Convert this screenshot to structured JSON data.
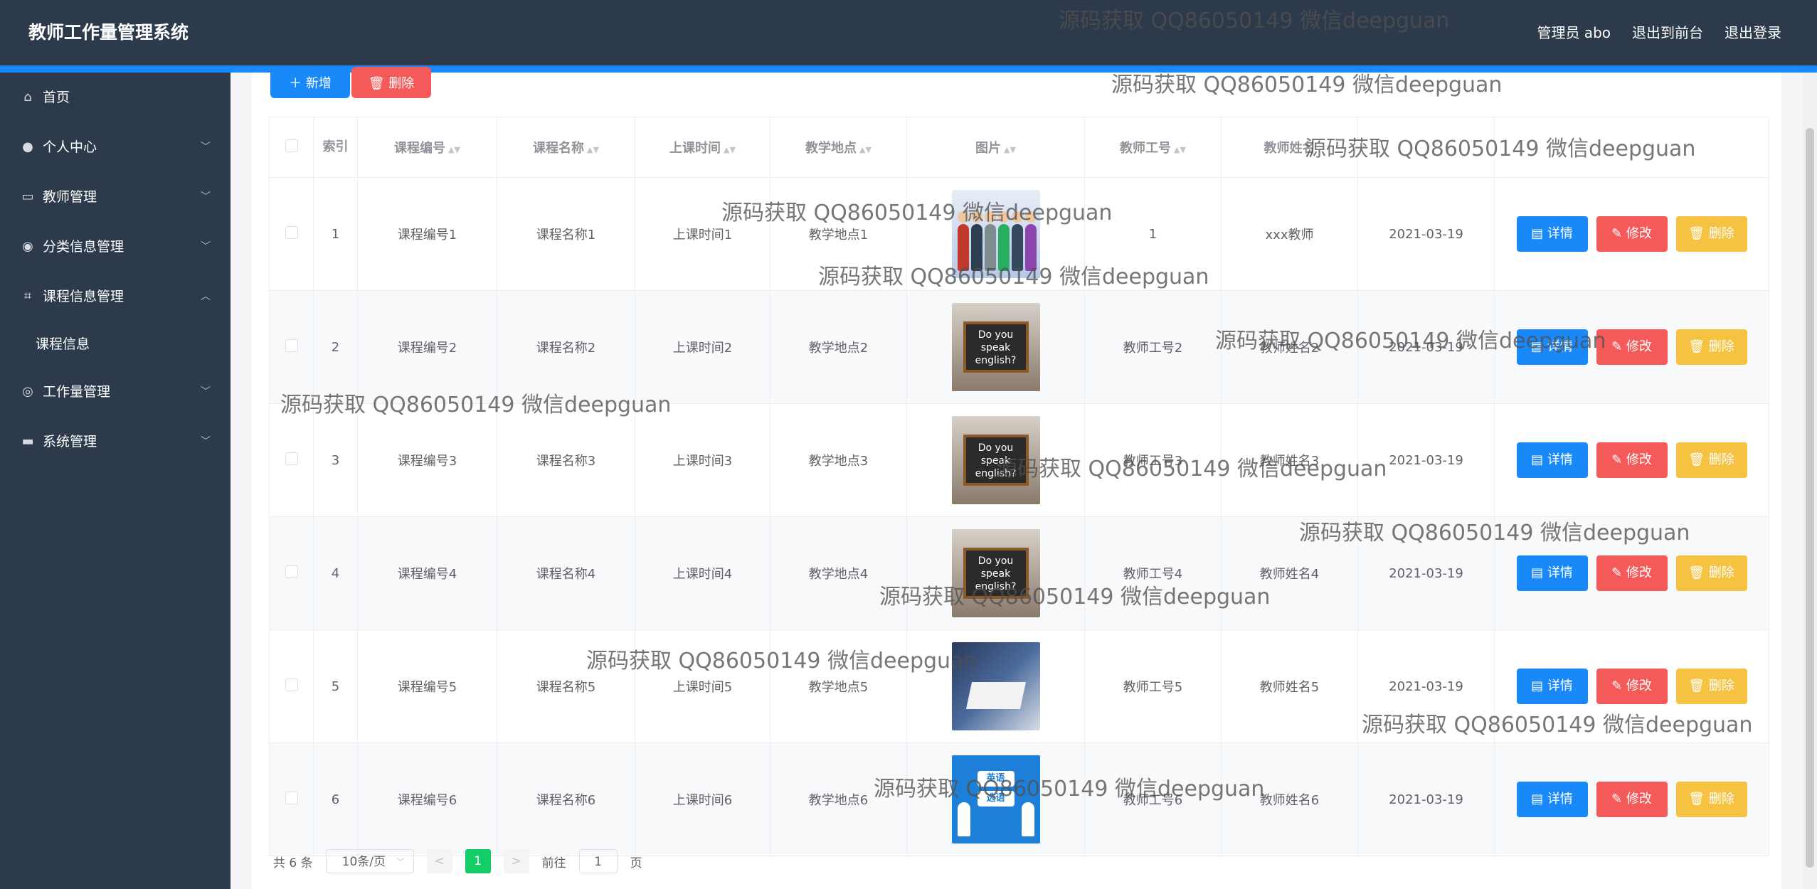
{
  "header": {
    "title": "教师工作量管理系统",
    "user": "管理员 abo",
    "front": "退出到前台",
    "logout": "退出登录"
  },
  "sidebar": {
    "items": [
      {
        "label": "首页",
        "icon": "home-icon"
      },
      {
        "label": "个人中心",
        "icon": "user-icon"
      },
      {
        "label": "教师管理",
        "icon": "monitor-icon"
      },
      {
        "label": "分类信息管理",
        "icon": "location-icon"
      },
      {
        "label": "课程信息管理",
        "icon": "crop-icon"
      },
      {
        "label": "课程信息",
        "icon": ""
      },
      {
        "label": "工作量管理",
        "icon": "compass-icon"
      },
      {
        "label": "系统管理",
        "icon": "settings-icon"
      }
    ]
  },
  "toolbar": {
    "add": "＋ 新增",
    "delete": "🗑 删除"
  },
  "table": {
    "headers": {
      "index": "索引",
      "course_no": "课程编号",
      "course_name": "课程名称",
      "class_time": "上课时间",
      "location": "教学地点",
      "image": "图片",
      "teacher_no": "教师工号",
      "teacher_name": "教师姓名",
      "date": "",
      "actions": ""
    },
    "rows": [
      {
        "index": "1",
        "course_no": "课程编号1",
        "course_name": "课程名称1",
        "class_time": "上课时间1",
        "location": "教学地点1",
        "teacher_no": "1",
        "teacher_name": "xxx教师",
        "date": "2021-03-19"
      },
      {
        "index": "2",
        "course_no": "课程编号2",
        "course_name": "课程名称2",
        "class_time": "上课时间2",
        "location": "教学地点2",
        "teacher_no": "教师工号2",
        "teacher_name": "教师姓名2",
        "date": "2021-03-19"
      },
      {
        "index": "3",
        "course_no": "课程编号3",
        "course_name": "课程名称3",
        "class_time": "上课时间3",
        "location": "教学地点3",
        "teacher_no": "教师工号3",
        "teacher_name": "教师姓名3",
        "date": "2021-03-19"
      },
      {
        "index": "4",
        "course_no": "课程编号4",
        "course_name": "课程名称4",
        "class_time": "上课时间4",
        "location": "教学地点4",
        "teacher_no": "教师工号4",
        "teacher_name": "教师姓名4",
        "date": "2021-03-19"
      },
      {
        "index": "5",
        "course_no": "课程编号5",
        "course_name": "课程名称5",
        "class_time": "上课时间5",
        "location": "教学地点5",
        "teacher_no": "教师工号5",
        "teacher_name": "教师姓名5",
        "date": "2021-03-19"
      },
      {
        "index": "6",
        "course_no": "课程编号6",
        "course_name": "课程名称6",
        "class_time": "上课时间6",
        "location": "教学地点6",
        "teacher_no": "教师工号6",
        "teacher_name": "教师姓名6",
        "date": "2021-03-19"
      }
    ],
    "board_text": [
      "Do you",
      "speak",
      "english?"
    ],
    "english_text": [
      "英语",
      "选语"
    ],
    "row_actions": {
      "detail": "▤ 详情",
      "edit": "✎ 修改",
      "delete": "🗑 删除"
    }
  },
  "pagination": {
    "total": "共 6 条",
    "page_size": "10条/页",
    "prev": "<",
    "current": "1",
    "next": ">",
    "goto": "前往",
    "goto_value": "1",
    "page_suffix": "页"
  },
  "watermark": "源码获取 QQ86050149 微信deepguan"
}
